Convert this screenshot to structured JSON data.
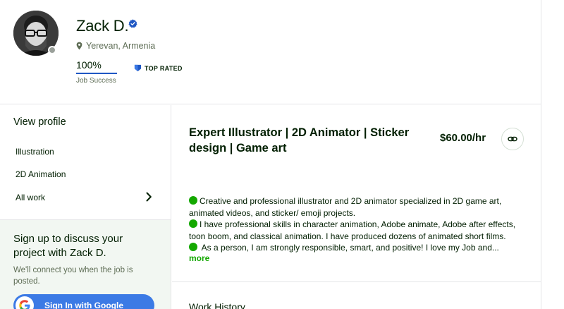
{
  "profile": {
    "name": "Zack D.",
    "location": "Yerevan, Armenia",
    "job_success_value": "100%",
    "job_success_fraction": 1.0,
    "job_success_label": "Job Success",
    "badge_label": "TOP RATED"
  },
  "sidebar": {
    "view_profile": "View profile",
    "items": [
      {
        "label": "Illustration"
      },
      {
        "label": "2D Animation"
      },
      {
        "label": "All work"
      }
    ]
  },
  "signup": {
    "title": "Sign up to discuss your project with Zack D.",
    "text": "We'll connect you when the job is posted.",
    "google_button": "Sign In with Google"
  },
  "main": {
    "title": "Expert Illustrator | 2D Animator | Sticker design | Game art",
    "rate": "$60.00/hr",
    "description": [
      "Creative and professional illustrator and 2D animator specialized in 2D game art,",
      "animated videos, and sticker/ emoji projects.",
      "I have professional skills in character animation, Adobe animate, Adobe after effects,",
      "toon boom, and classical animation. I have produced dozens of animated short films.",
      " As a person, I am strongly responsible, smart, and positive! I love my Job and..."
    ],
    "more_link": "more",
    "work_history": "Work History"
  },
  "colors": {
    "accent_green": "#14a800",
    "verified_blue": "#1f57c3",
    "google_blue": "#3c7ae5"
  },
  "icons": [
    "verified-icon",
    "location-pin-icon",
    "top-rated-badge-icon",
    "chevron-right-icon",
    "link-icon",
    "google-icon",
    "green-bullet-icon"
  ]
}
